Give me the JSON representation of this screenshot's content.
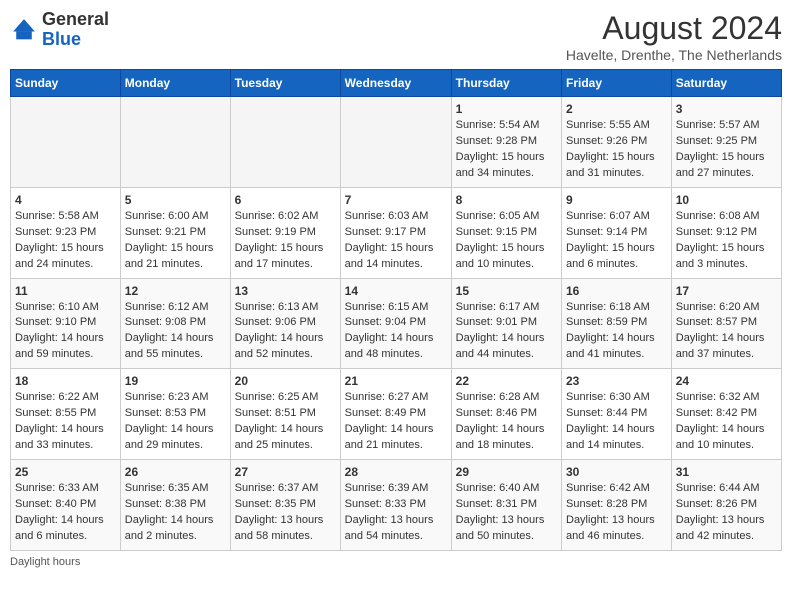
{
  "header": {
    "logo_general": "General",
    "logo_blue": "Blue",
    "month_year": "August 2024",
    "location": "Havelte, Drenthe, The Netherlands"
  },
  "days_of_week": [
    "Sunday",
    "Monday",
    "Tuesday",
    "Wednesday",
    "Thursday",
    "Friday",
    "Saturday"
  ],
  "weeks": [
    [
      {
        "day": "",
        "info": ""
      },
      {
        "day": "",
        "info": ""
      },
      {
        "day": "",
        "info": ""
      },
      {
        "day": "",
        "info": ""
      },
      {
        "day": "1",
        "info": "Sunrise: 5:54 AM\nSunset: 9:28 PM\nDaylight: 15 hours and 34 minutes."
      },
      {
        "day": "2",
        "info": "Sunrise: 5:55 AM\nSunset: 9:26 PM\nDaylight: 15 hours and 31 minutes."
      },
      {
        "day": "3",
        "info": "Sunrise: 5:57 AM\nSunset: 9:25 PM\nDaylight: 15 hours and 27 minutes."
      }
    ],
    [
      {
        "day": "4",
        "info": "Sunrise: 5:58 AM\nSunset: 9:23 PM\nDaylight: 15 hours and 24 minutes."
      },
      {
        "day": "5",
        "info": "Sunrise: 6:00 AM\nSunset: 9:21 PM\nDaylight: 15 hours and 21 minutes."
      },
      {
        "day": "6",
        "info": "Sunrise: 6:02 AM\nSunset: 9:19 PM\nDaylight: 15 hours and 17 minutes."
      },
      {
        "day": "7",
        "info": "Sunrise: 6:03 AM\nSunset: 9:17 PM\nDaylight: 15 hours and 14 minutes."
      },
      {
        "day": "8",
        "info": "Sunrise: 6:05 AM\nSunset: 9:15 PM\nDaylight: 15 hours and 10 minutes."
      },
      {
        "day": "9",
        "info": "Sunrise: 6:07 AM\nSunset: 9:14 PM\nDaylight: 15 hours and 6 minutes."
      },
      {
        "day": "10",
        "info": "Sunrise: 6:08 AM\nSunset: 9:12 PM\nDaylight: 15 hours and 3 minutes."
      }
    ],
    [
      {
        "day": "11",
        "info": "Sunrise: 6:10 AM\nSunset: 9:10 PM\nDaylight: 14 hours and 59 minutes."
      },
      {
        "day": "12",
        "info": "Sunrise: 6:12 AM\nSunset: 9:08 PM\nDaylight: 14 hours and 55 minutes."
      },
      {
        "day": "13",
        "info": "Sunrise: 6:13 AM\nSunset: 9:06 PM\nDaylight: 14 hours and 52 minutes."
      },
      {
        "day": "14",
        "info": "Sunrise: 6:15 AM\nSunset: 9:04 PM\nDaylight: 14 hours and 48 minutes."
      },
      {
        "day": "15",
        "info": "Sunrise: 6:17 AM\nSunset: 9:01 PM\nDaylight: 14 hours and 44 minutes."
      },
      {
        "day": "16",
        "info": "Sunrise: 6:18 AM\nSunset: 8:59 PM\nDaylight: 14 hours and 41 minutes."
      },
      {
        "day": "17",
        "info": "Sunrise: 6:20 AM\nSunset: 8:57 PM\nDaylight: 14 hours and 37 minutes."
      }
    ],
    [
      {
        "day": "18",
        "info": "Sunrise: 6:22 AM\nSunset: 8:55 PM\nDaylight: 14 hours and 33 minutes."
      },
      {
        "day": "19",
        "info": "Sunrise: 6:23 AM\nSunset: 8:53 PM\nDaylight: 14 hours and 29 minutes."
      },
      {
        "day": "20",
        "info": "Sunrise: 6:25 AM\nSunset: 8:51 PM\nDaylight: 14 hours and 25 minutes."
      },
      {
        "day": "21",
        "info": "Sunrise: 6:27 AM\nSunset: 8:49 PM\nDaylight: 14 hours and 21 minutes."
      },
      {
        "day": "22",
        "info": "Sunrise: 6:28 AM\nSunset: 8:46 PM\nDaylight: 14 hours and 18 minutes."
      },
      {
        "day": "23",
        "info": "Sunrise: 6:30 AM\nSunset: 8:44 PM\nDaylight: 14 hours and 14 minutes."
      },
      {
        "day": "24",
        "info": "Sunrise: 6:32 AM\nSunset: 8:42 PM\nDaylight: 14 hours and 10 minutes."
      }
    ],
    [
      {
        "day": "25",
        "info": "Sunrise: 6:33 AM\nSunset: 8:40 PM\nDaylight: 14 hours and 6 minutes."
      },
      {
        "day": "26",
        "info": "Sunrise: 6:35 AM\nSunset: 8:38 PM\nDaylight: 14 hours and 2 minutes."
      },
      {
        "day": "27",
        "info": "Sunrise: 6:37 AM\nSunset: 8:35 PM\nDaylight: 13 hours and 58 minutes."
      },
      {
        "day": "28",
        "info": "Sunrise: 6:39 AM\nSunset: 8:33 PM\nDaylight: 13 hours and 54 minutes."
      },
      {
        "day": "29",
        "info": "Sunrise: 6:40 AM\nSunset: 8:31 PM\nDaylight: 13 hours and 50 minutes."
      },
      {
        "day": "30",
        "info": "Sunrise: 6:42 AM\nSunset: 8:28 PM\nDaylight: 13 hours and 46 minutes."
      },
      {
        "day": "31",
        "info": "Sunrise: 6:44 AM\nSunset: 8:26 PM\nDaylight: 13 hours and 42 minutes."
      }
    ]
  ],
  "footer": {
    "note": "Daylight hours"
  }
}
